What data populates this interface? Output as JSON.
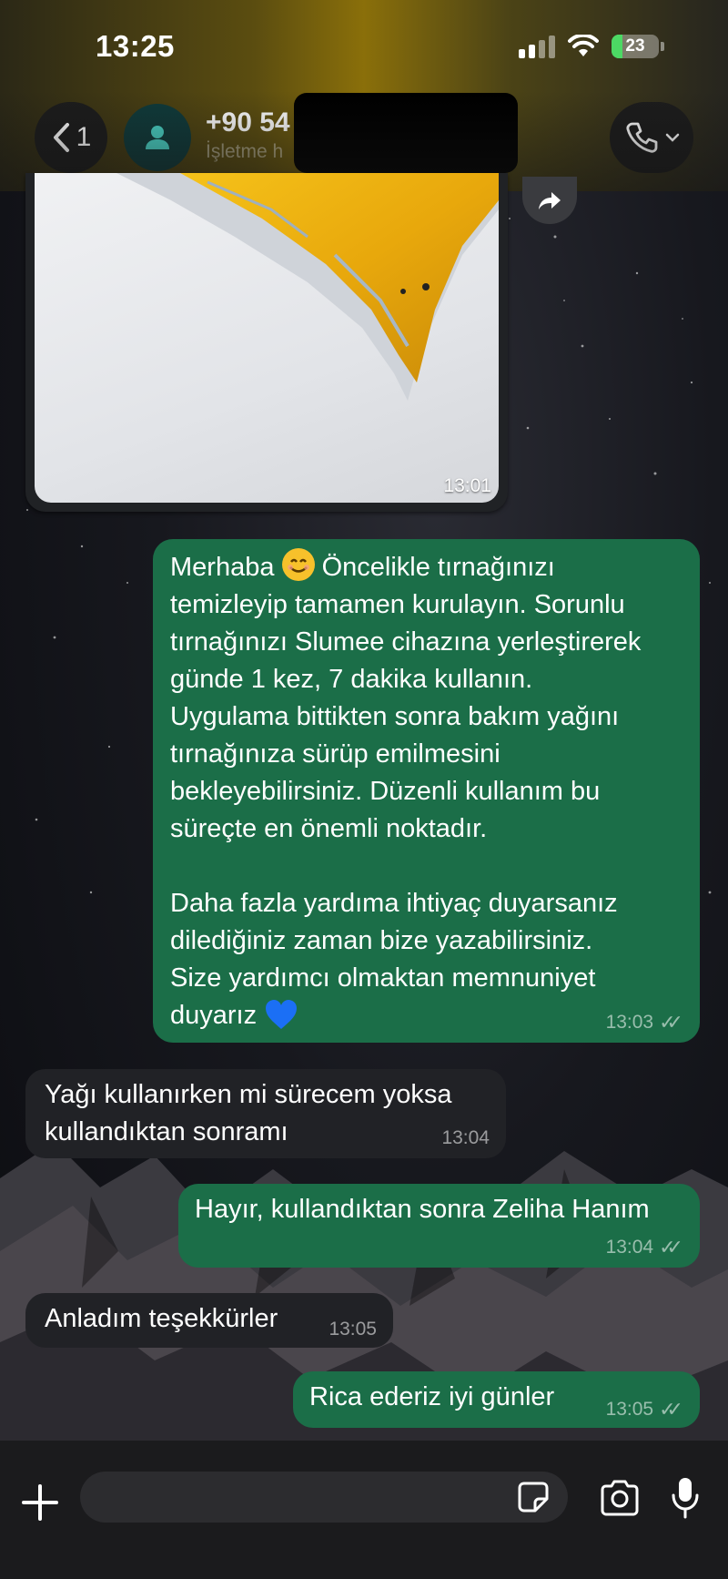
{
  "status_bar": {
    "time": "13:25",
    "battery": "23"
  },
  "header": {
    "back_count": "1",
    "contact_name": "+90 54",
    "contact_subtitle": "İşletme h",
    "call_icon": "phone-icon"
  },
  "messages": [
    {
      "type": "image",
      "direction": "in",
      "time": "13:01"
    },
    {
      "direction": "out",
      "text_part1": "Merhaba ",
      "text_part2": " Öncelikle tırnağınızı\ntemizleyip tamamen kurulayın. Sorunlu\ntırnağınızı Slumee cihazına yerleştirerek\ngünde 1 kez, 7 dakika kullanın.\nUygulama bittikten sonra bakım yağını\ntırnağınıza sürüp emilmesini\nbekleyebilirsiniz. Düzenli kullanım bu\nsüreçte en önemli noktadır.\n\nDaha fazla yardıma ihtiyaç duyarsanız\ndilediğiniz zaman bize yazabilirsiniz.\nSize yardımcı olmaktan memnuniyet\nduyarız ",
      "time": "13:03"
    },
    {
      "direction": "in",
      "text": "Yağı kullanırken mi sürecem yoksa\nkullandıktan sonramı",
      "time": "13:04"
    },
    {
      "direction": "out",
      "text": "Hayır, kullandıktan sonra Zeliha Hanım",
      "time": "13:04"
    },
    {
      "direction": "in",
      "text": "Anladım teşekkürler",
      "time": "13:05"
    },
    {
      "direction": "out",
      "text": "Rica ederiz iyi günler",
      "time": "13:05"
    }
  ],
  "composer": {
    "placeholder": ""
  },
  "colors": {
    "outgoing_bubble": "#1b6e48",
    "incoming_bubble": "#212226",
    "accent": "#4cd964"
  }
}
